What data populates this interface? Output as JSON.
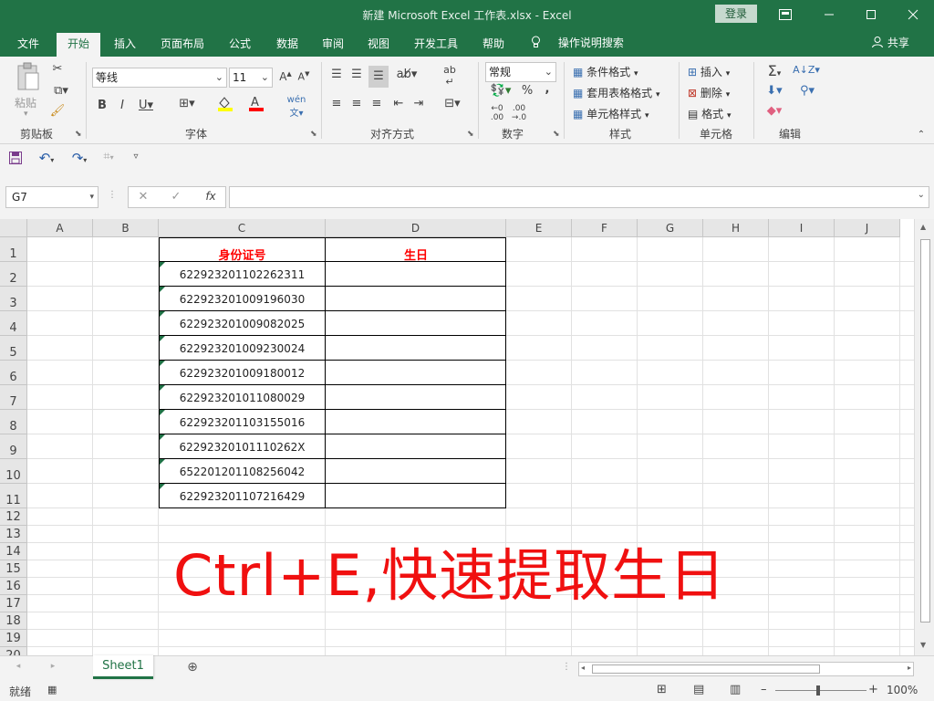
{
  "window": {
    "title": "新建 Microsoft Excel 工作表.xlsx  -  Excel",
    "login_label": "登录",
    "ribbon_display_icon": "ribbon-display-icon",
    "minimize_icon": "minimize-icon",
    "maximize_icon": "maximize-icon",
    "close_icon": "close-icon"
  },
  "tabs": [
    {
      "label": "文件"
    },
    {
      "label": "开始"
    },
    {
      "label": "插入"
    },
    {
      "label": "页面布局"
    },
    {
      "label": "公式"
    },
    {
      "label": "数据"
    },
    {
      "label": "审阅"
    },
    {
      "label": "视图"
    },
    {
      "label": "开发工具"
    },
    {
      "label": "帮助"
    }
  ],
  "active_tab": "开始",
  "tell_me": "操作说明搜索",
  "share_label": "共享",
  "ribbon": {
    "clipboard": {
      "label": "剪贴板",
      "paste": "粘贴"
    },
    "font": {
      "label": "字体",
      "font_name": "等线",
      "font_size": "11"
    },
    "alignment": {
      "label": "对齐方式"
    },
    "number": {
      "label": "数字",
      "format": "常规"
    },
    "styles": {
      "label": "样式",
      "conditional": "条件格式",
      "table": "套用表格格式",
      "cell_styles": "单元格样式"
    },
    "cells": {
      "label": "单元格",
      "insert": "插入",
      "delete": "删除",
      "format": "格式"
    },
    "editing": {
      "label": "编辑"
    }
  },
  "formula_bar": {
    "name_box": "G7",
    "formula": ""
  },
  "columns": [
    "A",
    "B",
    "C",
    "D",
    "E",
    "F",
    "G",
    "H",
    "I",
    "J"
  ],
  "rows": [
    "1",
    "2",
    "3",
    "4",
    "5",
    "6",
    "7",
    "8",
    "9",
    "10",
    "11",
    "12",
    "13",
    "14",
    "15",
    "16",
    "17",
    "18",
    "19",
    "20"
  ],
  "table": {
    "headers": [
      "身份证号",
      "生日"
    ],
    "header_color": "#ff0000",
    "ids": [
      "622923201102262311",
      "622923201009196030",
      "622923201009082025",
      "622923201009230024",
      "622923201009180012",
      "622923201011080029",
      "622923201103155016",
      "62292320101110262X",
      "652201201108256042",
      "622923201107216429"
    ]
  },
  "overlay_text": "Ctrl+E,快速提取生日",
  "sheets": [
    {
      "label": "Sheet1"
    }
  ],
  "status": {
    "ready": "就绪",
    "zoom": "100%"
  },
  "colors": {
    "excel_green": "#217346",
    "overlay_red": "#f01010"
  }
}
